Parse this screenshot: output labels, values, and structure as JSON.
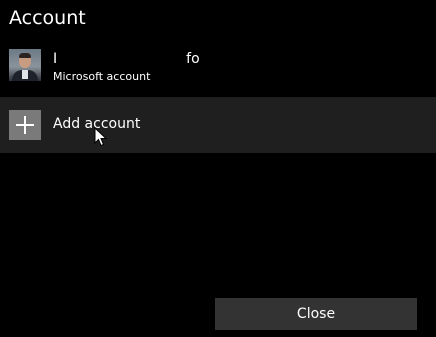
{
  "dialog": {
    "title": "Account"
  },
  "account": {
    "name": "I                             fo",
    "type": "Microsoft account",
    "avatar_icon": "user-photo"
  },
  "add_account": {
    "label": "Add account",
    "icon": "plus-icon"
  },
  "footer": {
    "close_label": "Close"
  },
  "colors": {
    "background": "#000000",
    "row_highlight": "#1f1f1f",
    "plus_tile": "#7a7a7a",
    "button": "#333333",
    "text": "#ffffff"
  }
}
